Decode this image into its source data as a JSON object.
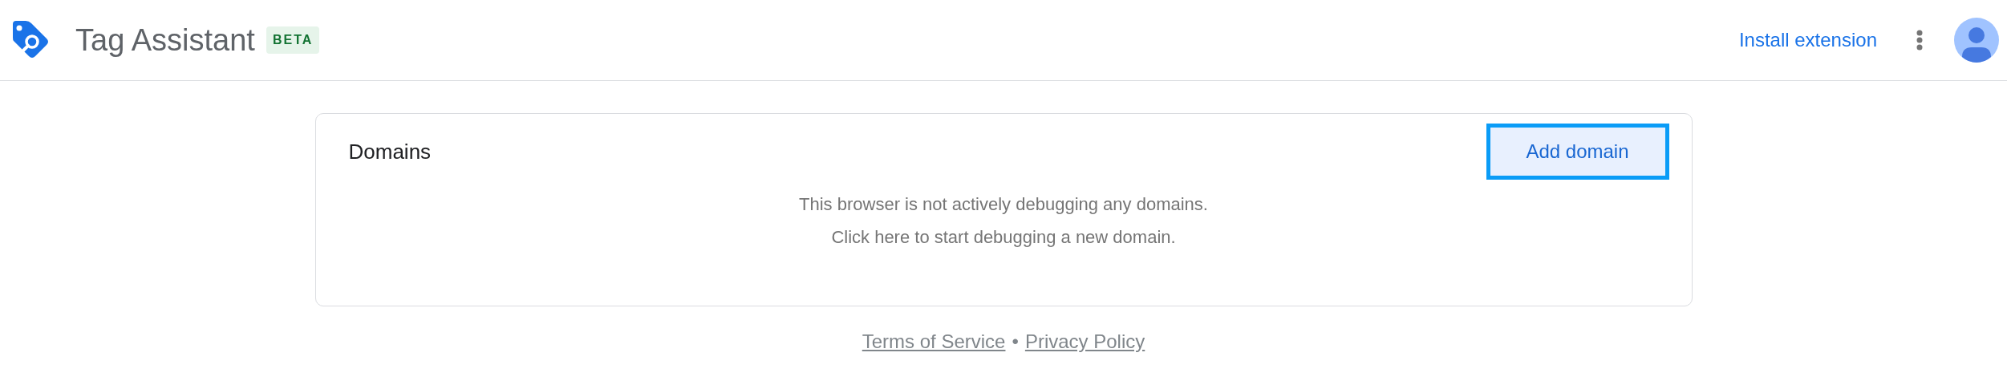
{
  "header": {
    "title": "Tag Assistant",
    "badge": "BETA",
    "install_link": "Install extension"
  },
  "domains_card": {
    "title": "Domains",
    "add_button": {
      "label": "Add domain",
      "focused": true
    },
    "empty_message": [
      "This browser is not actively debugging any domains.",
      "Click here to start debugging a new domain."
    ]
  },
  "footer": {
    "links": [
      "Terms of Service",
      "Privacy Policy"
    ],
    "separator": "•"
  }
}
